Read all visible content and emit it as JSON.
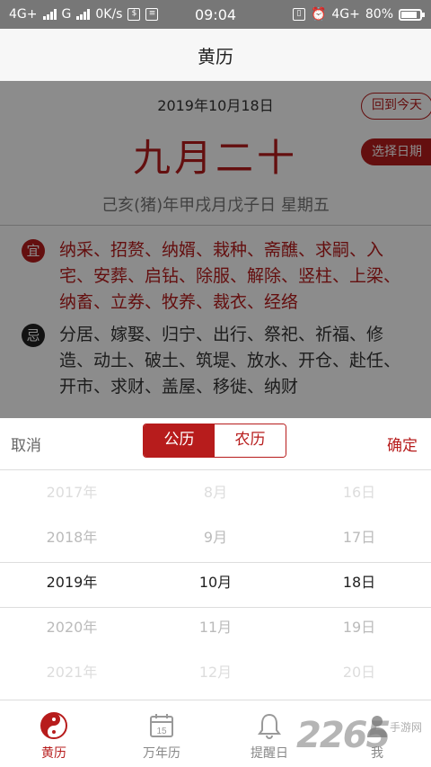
{
  "status_bar": {
    "network_left": "4G+",
    "network_mid": "G",
    "speed": "0K/s",
    "time": "09:04",
    "network_right": "4G+",
    "battery": "80%"
  },
  "header": {
    "title": "黄历"
  },
  "almanac": {
    "solar_date": "2019年10月18日",
    "today_button": "回到今天",
    "lunar_date": "九月二十",
    "pick_button": "选择日期",
    "ganzhi": "己亥(猪)年甲戌月戊子日 星期五",
    "yi_label": "宜",
    "yi_text": "纳采、招赘、纳婿、栽种、斋醮、求嗣、入宅、安葬、启钻、除服、解除、竖柱、上梁、纳畜、立券、牧养、裁衣、经络",
    "ji_label": "忌",
    "ji_text": "分居、嫁娶、归宁、出行、祭祀、祈福、修造、动土、破土、筑堤、放水、开仓、赴任、开市、求财、盖屋、移徙、纳财"
  },
  "picker": {
    "cancel": "取消",
    "confirm": "确定",
    "tab_solar": "公历",
    "tab_lunar": "农历",
    "years": [
      "2017年",
      "2018年",
      "2019年",
      "2020年",
      "2021年"
    ],
    "months": [
      "8月",
      "9月",
      "10月",
      "11月",
      "12月"
    ],
    "days": [
      "16日",
      "17日",
      "18日",
      "19日",
      "20日"
    ]
  },
  "nav": {
    "items": [
      {
        "label": "黄历",
        "icon": "yin-yang-icon"
      },
      {
        "label": "万年历",
        "icon": "calendar-icon"
      },
      {
        "label": "提醒日",
        "icon": "bell-icon"
      },
      {
        "label": "我",
        "icon": "person-icon"
      }
    ],
    "calendar_icon_day": "15"
  },
  "watermark": {
    "number": "2265",
    "text": "手游网"
  },
  "colors": {
    "accent": "#b71c1c",
    "overlay": "rgba(0,0,0,0.45)"
  }
}
